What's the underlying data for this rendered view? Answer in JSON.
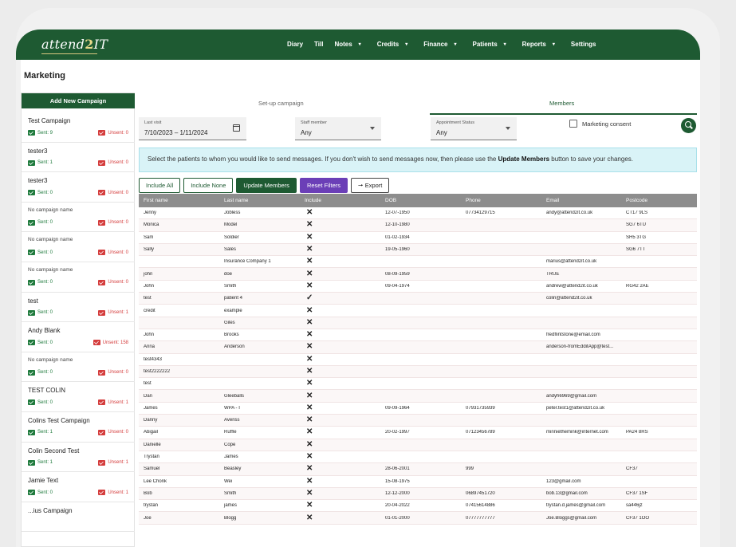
{
  "app": {
    "logo_main": "attend",
    "logo_two": "2",
    "logo_it": "IT"
  },
  "nav": [
    {
      "label": "Diary",
      "caret": false
    },
    {
      "label": "Till",
      "caret": false
    },
    {
      "label": "Notes",
      "caret": true
    },
    {
      "label": "Credits",
      "caret": true
    },
    {
      "label": "Finance",
      "caret": true
    },
    {
      "label": "Patients",
      "caret": true
    },
    {
      "label": "Reports",
      "caret": true
    },
    {
      "label": "Settings",
      "caret": false
    }
  ],
  "page": {
    "title": "Marketing"
  },
  "sidebar": {
    "add_label": "Add New Campaign",
    "campaigns": [
      {
        "name": "Test Campaign",
        "small": false,
        "sent": "Sent: 9",
        "unsent": "Unsent: 0"
      },
      {
        "name": "tester3",
        "small": false,
        "sent": "Sent: 1",
        "unsent": "Unsent: 0"
      },
      {
        "name": "tester3",
        "small": false,
        "sent": "Sent: 0",
        "unsent": "Unsent: 0"
      },
      {
        "name": "No campaign name",
        "small": true,
        "sent": "Sent: 0",
        "unsent": "Unsent: 0"
      },
      {
        "name": "No campaign name",
        "small": true,
        "sent": "Sent: 0",
        "unsent": "Unsent: 0"
      },
      {
        "name": "No campaign name",
        "small": true,
        "sent": "Sent: 0",
        "unsent": "Unsent: 0"
      },
      {
        "name": "test",
        "small": false,
        "sent": "Sent: 0",
        "unsent": "Unsent: 1"
      },
      {
        "name": "Andy Blank",
        "small": false,
        "sent": "Sent: 0",
        "unsent": "Unsent: 158"
      },
      {
        "name": "No campaign name",
        "small": true,
        "sent": "Sent: 0",
        "unsent": "Unsent: 0"
      },
      {
        "name": "TEST COLIN",
        "small": false,
        "sent": "Sent: 0",
        "unsent": "Unsent: 1"
      },
      {
        "name": "Colins Test Campaign",
        "small": false,
        "sent": "Sent: 1",
        "unsent": "Unsent: 0"
      },
      {
        "name": "Colin Second Test",
        "small": false,
        "sent": "Sent: 1",
        "unsent": "Unsent: 1"
      },
      {
        "name": "Jamie Text",
        "small": false,
        "sent": "Sent: 0",
        "unsent": "Unsent: 1"
      },
      {
        "name": "...ius Campaign",
        "small": false,
        "sent": "",
        "unsent": ""
      }
    ]
  },
  "tabs": {
    "setup": "Set-up campaign",
    "members": "Members"
  },
  "filters": {
    "last_visit_label": "Last visit",
    "last_visit_value": "7/10/2023 – 1/11/2024",
    "staff_label": "Staff member",
    "staff_value": "Any",
    "appt_label": "Appointment Status",
    "appt_value": "Any",
    "consent_label": "Marketing consent"
  },
  "info": {
    "text_before": "Select the patients to whom you would like to send messages. If you don't wish to send messages now, then please use the ",
    "bold": "Update Members",
    "text_after": " button to save your changes."
  },
  "buttons": {
    "include_all": "Include All",
    "include_none": "Include None",
    "update_members": "Update Members",
    "reset_filters": "Reset Filters",
    "export": "Export"
  },
  "table": {
    "headers": [
      "First name",
      "Last name",
      "Include",
      "DOB",
      "Phone",
      "Email",
      "Postcode"
    ],
    "rows": [
      [
        "Jenny",
        "Jobless",
        "✕",
        "12-07-1950",
        "07734129715",
        "andy@attend2it.co.uk",
        "CT17 9LS"
      ],
      [
        "Monica",
        "Model",
        "✕",
        "12-10-1980",
        "",
        "",
        "SG7 6TU"
      ],
      [
        "Sam",
        "Soldier",
        "✕",
        "01-02-1934",
        "",
        "",
        "SH5 3TG"
      ],
      [
        "Sally",
        "Sales",
        "✕",
        "19-05-1960",
        "",
        "",
        "SG6 7TT"
      ],
      [
        "",
        "Insurance Company 1",
        "✕",
        "",
        "",
        "marius@attend2it.co.uk",
        ""
      ],
      [
        "john",
        "doe",
        "✕",
        "08-09-1959",
        "",
        "TRUE",
        ""
      ],
      [
        "John",
        "Smith",
        "✕",
        "09-04-1974",
        "",
        "andrew@attend2it.co.uk",
        "RG42 2AE"
      ],
      [
        "test",
        "patient 4",
        "✓",
        "",
        "",
        "colin@attend2it.co.uk",
        ""
      ],
      [
        "credit",
        "example",
        "✕",
        "",
        "",
        "",
        ""
      ],
      [
        "",
        "Giles",
        "✕",
        "",
        "",
        "",
        ""
      ],
      [
        "John",
        "Brooks",
        "✕",
        "",
        "",
        "fredflintstone@email.com",
        ""
      ],
      [
        "Anna",
        "Anderson",
        "✕",
        "",
        "",
        "anderson-fromEdditApp@test...",
        ""
      ],
      [
        "test4343",
        "",
        "✕",
        "",
        "",
        "",
        ""
      ],
      [
        "test2222222",
        "",
        "✕",
        "",
        "",
        "",
        ""
      ],
      [
        "test",
        "",
        "✕",
        "",
        "",
        "",
        ""
      ],
      [
        "Dan",
        "Gleeballs",
        "✕",
        "",
        "",
        "andyh6969@gmail.com",
        ""
      ],
      [
        "James",
        "WPA - I",
        "✕",
        "09-09-1964",
        "07931735939",
        "peter.test1@attend2it.co.uk",
        ""
      ],
      [
        "Danny",
        "Averiss",
        "✕",
        "",
        "",
        "",
        ""
      ],
      [
        "Abigail",
        "Ruffle",
        "✕",
        "20-02-1997",
        "07123456789",
        "minniethemink@internet.com",
        "PA24 8RS"
      ],
      [
        "Danielle",
        "Cope",
        "✕",
        "",
        "",
        "",
        ""
      ],
      [
        "Trystan",
        "James",
        "✕",
        "",
        "",
        "",
        ""
      ],
      [
        "Samuel",
        "Beasley",
        "✕",
        "28-06-2001",
        "999",
        "",
        "CF37"
      ],
      [
        "Lee Chonk",
        "Wei",
        "✕",
        "15-08-1975",
        "",
        "123@gmail.com",
        ""
      ],
      [
        "Bob",
        "Smith",
        "✕",
        "12-12-2000",
        "06897451720",
        "bob.13@gmail.com",
        "CF37 1SF"
      ],
      [
        "trystan",
        "james",
        "✕",
        "20-04-2022",
        "07415614886",
        "trystan.d.james@gmail.com",
        "sa446jz"
      ],
      [
        "Joe",
        "Blogg",
        "✕",
        "01-01-2000",
        "07777777777",
        "Joe.Bloggs@gmail.com",
        "CF37 1OO"
      ]
    ]
  }
}
